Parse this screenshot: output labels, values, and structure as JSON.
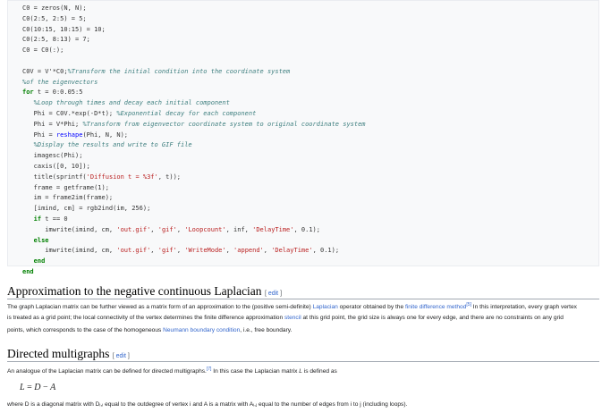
{
  "code": [
    [
      {
        "t": "C0 = zeros(N, N);",
        "c": ""
      }
    ],
    [
      {
        "t": "C0(2:5, 2:5) = 5;",
        "c": ""
      }
    ],
    [
      {
        "t": "C0(10:15, 10:15) = 10;",
        "c": ""
      }
    ],
    [
      {
        "t": "C0(2:5, 8:13) = 7;",
        "c": ""
      }
    ],
    [
      {
        "t": "C0 = C0(:);",
        "c": ""
      }
    ],
    [],
    [
      {
        "t": "C0V = V'*C0;",
        "c": ""
      },
      {
        "t": "%Transform the initial condition into the coordinate system",
        "c": "cmt"
      }
    ],
    [
      {
        "t": "%of the eigenvectors",
        "c": "cmt"
      }
    ],
    [
      {
        "t": "for",
        "c": "kw"
      },
      {
        "t": " t = 0:0.05:5",
        "c": ""
      }
    ],
    [
      {
        "t": "   %Loop through times and decay each initial component",
        "c": "cmt"
      }
    ],
    [
      {
        "t": "   Phi = C0V.*exp(-D*t); ",
        "c": ""
      },
      {
        "t": "%Exponential decay for each component",
        "c": "cmt"
      }
    ],
    [
      {
        "t": "   Phi = V*Phi; ",
        "c": ""
      },
      {
        "t": "%Transform from eigenvector coordinate system to original coordinate system",
        "c": "cmt"
      }
    ],
    [
      {
        "t": "   Phi = ",
        "c": ""
      },
      {
        "t": "reshape",
        "c": "fn"
      },
      {
        "t": "(Phi, N, N);",
        "c": ""
      }
    ],
    [
      {
        "t": "   %Display the results and write to GIF file",
        "c": "cmt"
      }
    ],
    [
      {
        "t": "   imagesc(Phi);",
        "c": ""
      }
    ],
    [
      {
        "t": "   caxis([0, 10]);",
        "c": ""
      }
    ],
    [
      {
        "t": "   title(sprintf(",
        "c": ""
      },
      {
        "t": "'Diffusion t = %3f'",
        "c": "str"
      },
      {
        "t": ", t));",
        "c": ""
      }
    ],
    [
      {
        "t": "   frame = getframe(1);",
        "c": ""
      }
    ],
    [
      {
        "t": "   im = frame2im(frame);",
        "c": ""
      }
    ],
    [
      {
        "t": "   [imind, cm] = rgb2ind(im, 256);",
        "c": ""
      }
    ],
    [
      {
        "t": "   ",
        "c": ""
      },
      {
        "t": "if",
        "c": "kw"
      },
      {
        "t": " t == 0",
        "c": ""
      }
    ],
    [
      {
        "t": "      imwrite(imind, cm, ",
        "c": ""
      },
      {
        "t": "'out.gif'",
        "c": "str"
      },
      {
        "t": ", ",
        "c": ""
      },
      {
        "t": "'gif'",
        "c": "str"
      },
      {
        "t": ", ",
        "c": ""
      },
      {
        "t": "'Loopcount'",
        "c": "str"
      },
      {
        "t": ", inf, ",
        "c": ""
      },
      {
        "t": "'DelayTime'",
        "c": "str"
      },
      {
        "t": ", 0.1);",
        "c": ""
      }
    ],
    [
      {
        "t": "   ",
        "c": ""
      },
      {
        "t": "else",
        "c": "kw"
      }
    ],
    [
      {
        "t": "      imwrite(imind, cm, ",
        "c": ""
      },
      {
        "t": "'out.gif'",
        "c": "str"
      },
      {
        "t": ", ",
        "c": ""
      },
      {
        "t": "'gif'",
        "c": "str"
      },
      {
        "t": ", ",
        "c": ""
      },
      {
        "t": "'WriteMode'",
        "c": "str"
      },
      {
        "t": ", ",
        "c": ""
      },
      {
        "t": "'append'",
        "c": "str"
      },
      {
        "t": ", ",
        "c": ""
      },
      {
        "t": "'DelayTime'",
        "c": "str"
      },
      {
        "t": ", 0.1);",
        "c": ""
      }
    ],
    [
      {
        "t": "   ",
        "c": ""
      },
      {
        "t": "end",
        "c": "kw"
      }
    ],
    [
      {
        "t": "end",
        "c": "kw"
      }
    ]
  ],
  "section1": {
    "title": "Approximation to the negative continuous Laplacian",
    "edit_open": "[ ",
    "edit_label": "edit",
    "edit_close": " ]",
    "p1a": "The graph Laplacian matrix can be further viewed as a matrix form of an approximation to the (positive semi-definite) ",
    "p1_link1": "Laplacian",
    "p1b": " operator obtained by the ",
    "p1_link2": "finite difference method",
    "p1_sup": "[5]",
    "p1c": " In this interpretation, every graph vertex",
    "p2a": "is treated as a grid point; the local connectivity of the vertex determines the finite difference approximation ",
    "p2_link": "stencil",
    "p2b": " at this grid point, the grid size is always one for every edge, and there are no constraints on any grid",
    "p3a": "points, which corresponds to the case of the homogeneous ",
    "p3_link": "Neumann boundary condition",
    "p3b": ", i.e., free boundary."
  },
  "section2": {
    "title": "Directed multigraphs",
    "edit_open": "[ ",
    "edit_label": "edit",
    "edit_close": " ]",
    "p1a": "An analogue of the Laplacian matrix can be defined for directed multigraphs.",
    "p1_sup": "[7]",
    "p1b": " In this case the Laplacian matrix ",
    "p1_var": "L",
    "p1c": " is defined as",
    "formula_lhs": "L",
    "formula_eq": " = ",
    "formula_d": "D",
    "formula_minus": " − ",
    "formula_a": "A",
    "p2": "where D is a diagonal matrix with Dᵢ,ᵢ equal to the outdegree of vertex i and A is a matrix with Aᵢ,ⱼ equal to the number of edges from i to j (including loops)."
  }
}
